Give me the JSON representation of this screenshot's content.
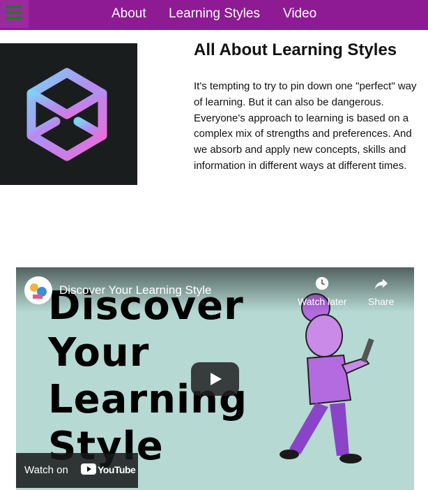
{
  "nav": {
    "links": [
      {
        "label": "About"
      },
      {
        "label": "Learning Styles"
      },
      {
        "label": "Video"
      }
    ]
  },
  "colors": {
    "nav_background": "#8e1a94",
    "menu_icon": "#1f7a1f",
    "video_background": "#b6d9d3"
  },
  "intro": {
    "heading": "All About Learning Styles",
    "paragraph": "It's tempting to try to pin down one \"perfect\" way of learning. But it can also be dangerous. Everyone's approach to learning is based on a complex mix of strengths and preferences. And we absorb and apply new concepts, skills and information in different ways at different times."
  },
  "video": {
    "title": "Discover Your Learning Style",
    "thumbnail_lines": [
      "Discover",
      "Your",
      "Learning",
      "Style"
    ],
    "watch_later_label": "Watch later",
    "share_label": "Share",
    "watch_on_label": "Watch on",
    "youtube_label": "YouTube"
  }
}
